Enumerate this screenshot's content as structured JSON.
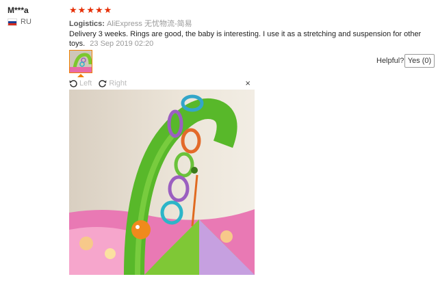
{
  "review": {
    "user_name": "M***a",
    "country": "RU",
    "rating": 5,
    "logistics_label": "Logistics:",
    "logistics_value": "AliExpress 无忧物流-简易",
    "text": "Delivery 3 weeks. Rings are good, the baby is interesting. I use it as a stretching and suspension for other toys.",
    "date": "23 Sep 2019 02:20",
    "helpful_label": "Helpful?",
    "yes_label": "Yes (0)"
  },
  "viewer": {
    "rotate_left_label": "Left",
    "rotate_right_label": "Right",
    "close_label": "×"
  },
  "colors": {
    "star": "#e62e04",
    "thumb_border": "#f08000",
    "flag": [
      "#ffffff",
      "#1c3f94",
      "#d52b1e"
    ]
  }
}
